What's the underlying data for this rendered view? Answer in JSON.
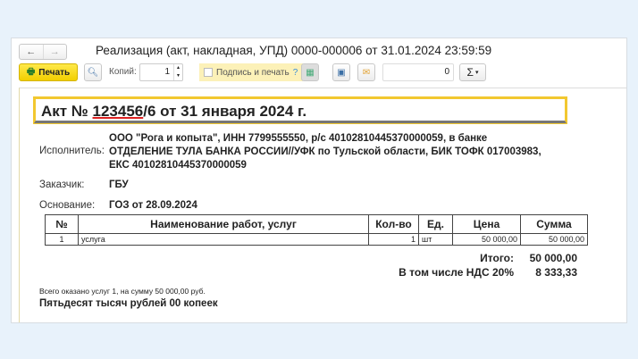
{
  "window": {
    "title": "Реализация (акт, накладная, УПД) 0000-000006 от 31.01.2024 23:59:59"
  },
  "toolbar": {
    "print_label": "Печать",
    "copies_label": "Копий:",
    "copies_value": "1",
    "sign_label": "Подпись и печать",
    "help": "?",
    "number_value": "0",
    "sum_label": "Σ"
  },
  "doc": {
    "title_prefix": "Акт № ",
    "title_number": "123456",
    "title_rest": "/6 от 31 января 2024 г.",
    "executor_label": "Исполнитель:",
    "executor_lines": [
      "ООО \"Рога и копыта\", ИНН 7799555550, р/с 40102810445370000059, в банке",
      "ОТДЕЛЕНИЕ ТУЛА БАНКА РОССИИ//УФК по Тульской области, БИК ТОФК 017003983,",
      "ЕКС 40102810445370000059"
    ],
    "customer_label": "Заказчик:",
    "customer": "ГБУ",
    "basis_label": "Основание:",
    "basis": "ГОЗ от 28.09.2024",
    "table": {
      "headers": [
        "№",
        "Наименование работ, услуг",
        "Кол-во",
        "Ед.",
        "Цена",
        "Сумма"
      ],
      "rows": [
        [
          "1",
          "услуга",
          "1",
          "шт",
          "50 000,00",
          "50 000,00"
        ]
      ]
    },
    "total_label": "Итого:",
    "total": "50 000,00",
    "vat_label": "В том числе НДС 20%",
    "vat": "8 333,33",
    "summary": "Всего оказано услуг 1, на сумму 50 000,00 руб.",
    "amount_words": "Пятьдесят тысяч рублей 00 копеек"
  }
}
